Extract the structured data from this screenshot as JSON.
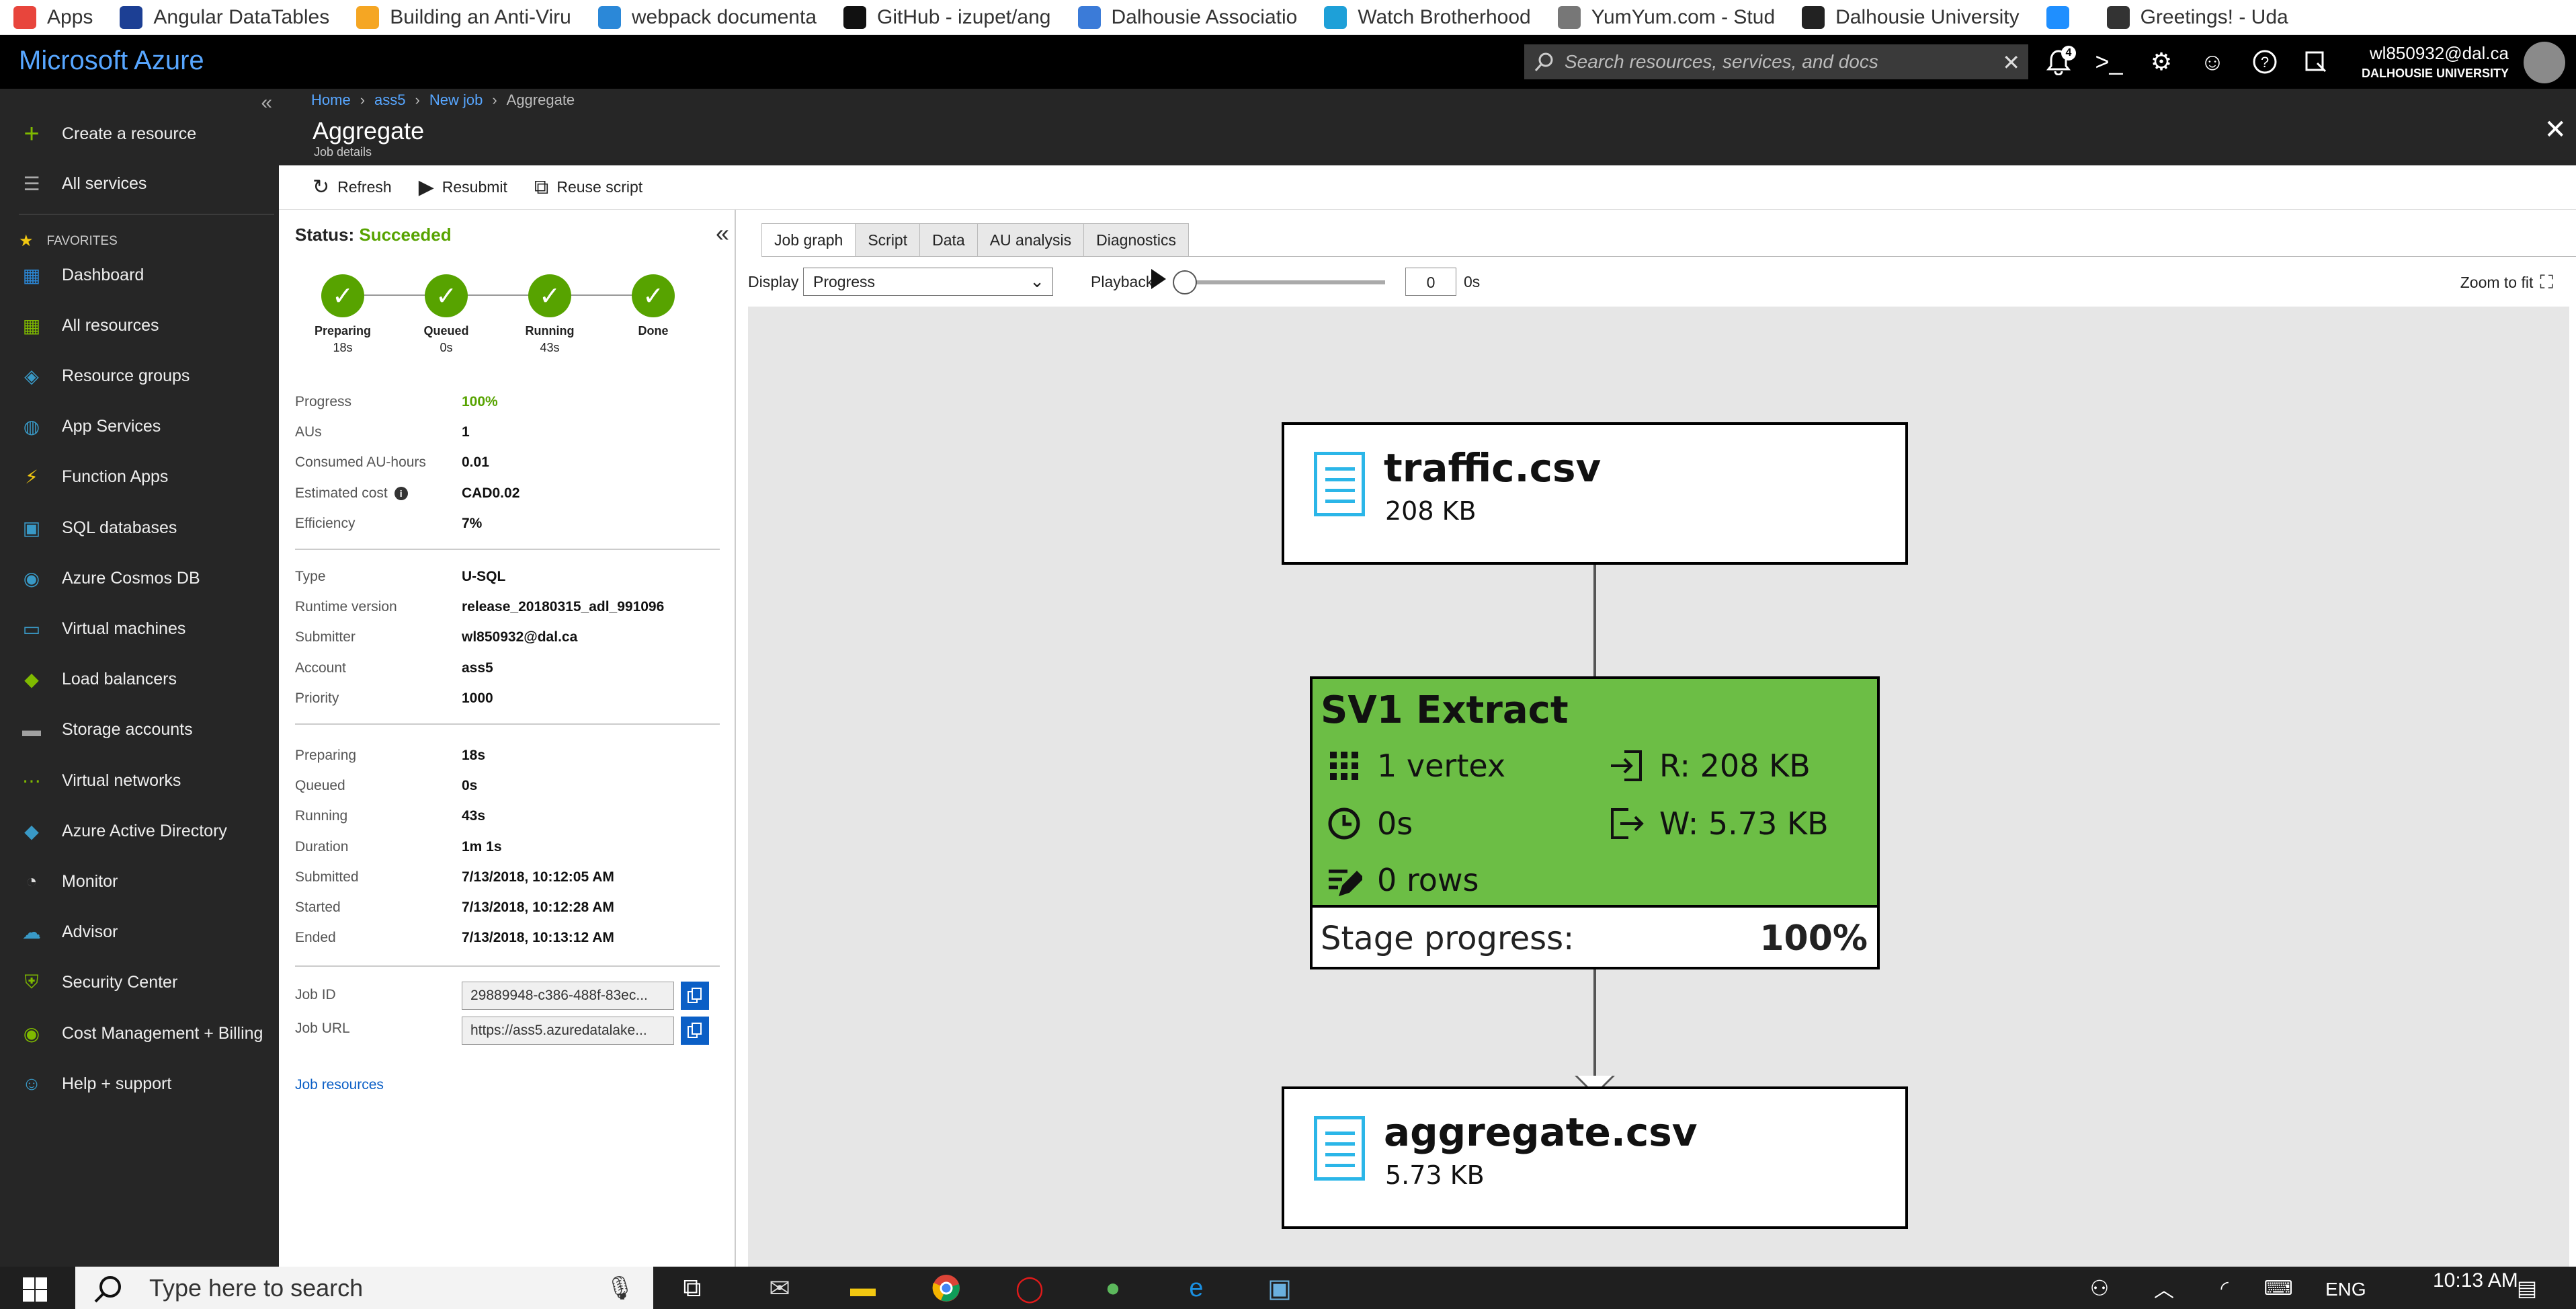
{
  "bookmarks": [
    {
      "label": "Apps",
      "icon": "apps-grid-icon",
      "color": "#e8453c"
    },
    {
      "label": "Angular DataTables",
      "icon": "shield-icon",
      "color": "#1c3f94"
    },
    {
      "label": "Building an Anti-Viru",
      "icon": "check-badge-icon",
      "color": "#f5a623"
    },
    {
      "label": "webpack documenta",
      "icon": "cube-icon",
      "color": "#2b88d8"
    },
    {
      "label": "GitHub - izupet/ang",
      "icon": "github-icon",
      "color": "#111111"
    },
    {
      "label": "Dalhousie Associatio",
      "icon": "w-logo-icon",
      "color": "#3b7bd8"
    },
    {
      "label": "Watch Brotherhood",
      "icon": "play-icon",
      "color": "#1ea0d8"
    },
    {
      "label": "YumYum.com - Stud",
      "icon": "page-icon",
      "color": "#777777"
    },
    {
      "label": "Dalhousie University",
      "icon": "crest-icon",
      "color": "#222222"
    },
    {
      "label": "",
      "icon": "u-logo-icon",
      "color": "#1f8fff"
    },
    {
      "label": "Greetings! - Uda",
      "icon": "mask-icon",
      "color": "#333333"
    }
  ],
  "azure": {
    "brand": "Microsoft Azure",
    "search_placeholder": "Search resources, services, and docs",
    "notification_count": "4",
    "account_email": "wl850932@dal.ca",
    "account_org": "DALHOUSIE UNIVERSITY"
  },
  "nav": {
    "create": "Create a resource",
    "all_services": "All services",
    "favorites_label": "FAVORITES",
    "items": [
      {
        "label": "Dashboard",
        "icon": "dashboard-icon",
        "color": "#2b88d8"
      },
      {
        "label": "All resources",
        "icon": "grid-icon",
        "color": "#7fba00"
      },
      {
        "label": "Resource groups",
        "icon": "cube-icon",
        "color": "#3999c6"
      },
      {
        "label": "App Services",
        "icon": "globe-icon",
        "color": "#3999c6"
      },
      {
        "label": "Function Apps",
        "icon": "bolt-icon",
        "color": "#f2c811"
      },
      {
        "label": "SQL databases",
        "icon": "sql-icon",
        "color": "#3999c6"
      },
      {
        "label": "Azure Cosmos DB",
        "icon": "planet-icon",
        "color": "#3999c6"
      },
      {
        "label": "Virtual machines",
        "icon": "monitor-icon",
        "color": "#3999c6"
      },
      {
        "label": "Load balancers",
        "icon": "diamond-icon",
        "color": "#7fba00"
      },
      {
        "label": "Storage accounts",
        "icon": "storage-icon",
        "color": "#a0a0a0"
      },
      {
        "label": "Virtual networks",
        "icon": "network-icon",
        "color": "#7fba00"
      },
      {
        "label": "Azure Active Directory",
        "icon": "aad-icon",
        "color": "#3999c6"
      },
      {
        "label": "Monitor",
        "icon": "gauge-icon",
        "color": "#dddddd"
      },
      {
        "label": "Advisor",
        "icon": "cloud-icon",
        "color": "#3999c6"
      },
      {
        "label": "Security Center",
        "icon": "shield-icon",
        "color": "#7fba00"
      },
      {
        "label": "Cost Management + Billing",
        "icon": "coin-icon",
        "color": "#7fba00"
      },
      {
        "label": "Help + support",
        "icon": "person-icon",
        "color": "#3999c6"
      }
    ]
  },
  "blade": {
    "breadcrumb": [
      "Home",
      "ass5",
      "New job",
      "Aggregate"
    ],
    "title": "Aggregate",
    "subtitle": "Job details"
  },
  "commands": {
    "refresh": "Refresh",
    "resubmit": "Resubmit",
    "reuse": "Reuse script"
  },
  "details": {
    "status_label": "Status:",
    "status_value": "Succeeded",
    "steps": [
      {
        "label": "Preparing",
        "time": "18s"
      },
      {
        "label": "Queued",
        "time": "0s"
      },
      {
        "label": "Running",
        "time": "43s"
      },
      {
        "label": "Done",
        "time": ""
      }
    ],
    "group1": [
      {
        "key": "Progress",
        "value": "100%"
      },
      {
        "key": "AUs",
        "value": "1"
      },
      {
        "key": "Consumed AU-hours",
        "value": "0.01"
      },
      {
        "key": "Estimated cost",
        "value": "CAD0.02"
      },
      {
        "key": "Efficiency",
        "value": "7%"
      }
    ],
    "group2": [
      {
        "key": "Type",
        "value": "U-SQL"
      },
      {
        "key": "Runtime version",
        "value": "release_20180315_adl_991096"
      },
      {
        "key": "Submitter",
        "value": "wl850932@dal.ca"
      },
      {
        "key": "Account",
        "value": "ass5"
      },
      {
        "key": "Priority",
        "value": "1000"
      }
    ],
    "group3": [
      {
        "key": "Preparing",
        "value": "18s"
      },
      {
        "key": "Queued",
        "value": "0s"
      },
      {
        "key": "Running",
        "value": "43s"
      },
      {
        "key": "Duration",
        "value": "1m 1s"
      },
      {
        "key": "Submitted",
        "value": "7/13/2018, 10:12:05 AM"
      },
      {
        "key": "Started",
        "value": "7/13/2018, 10:12:28 AM"
      },
      {
        "key": "Ended",
        "value": "7/13/2018, 10:13:12 AM"
      }
    ],
    "job_id_label": "Job ID",
    "job_id_value": "29889948-c386-488f-83ec...",
    "job_url_label": "Job URL",
    "job_url_value": "https://ass5.azuredatalake...",
    "job_resources": "Job resources"
  },
  "graph": {
    "tabs": [
      "Job graph",
      "Script",
      "Data",
      "AU analysis",
      "Diagnostics"
    ],
    "display_label": "Display",
    "display_value": "Progress",
    "playback_label": "Playback",
    "playback_value": "0",
    "playback_unit": "0s",
    "playback_fraction": 0,
    "zoom_label": "Zoom to fit",
    "input_file": {
      "name": "traffic.csv",
      "size": "208 KB"
    },
    "stage": {
      "title": "SV1 Extract",
      "vertex": "1 vertex",
      "read": "R: 208 KB",
      "time": "0s",
      "write": "W: 5.73 KB",
      "rows": "0 rows",
      "progress_label": "Stage progress:",
      "progress_value": "100%",
      "color": "#6cbe45"
    },
    "output_file": {
      "name": "aggregate.csv",
      "size": "5.73 KB"
    }
  },
  "taskbar": {
    "search_placeholder": "Type here to search",
    "lang": "ENG",
    "time": "10:13 AM"
  },
  "colors": {
    "azure_blue": "#57a6ff",
    "success_green": "#57a300",
    "link_blue": "#0b5fc6"
  }
}
